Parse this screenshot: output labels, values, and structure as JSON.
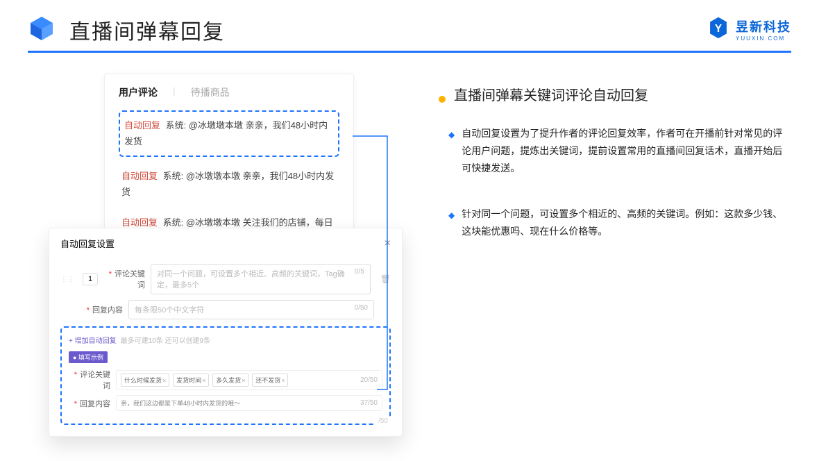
{
  "header": {
    "title": "直播间弹幕回复",
    "brand_name": "昱新科技",
    "brand_sub": "YUUXIN.COM"
  },
  "comments": {
    "tab_active": "用户评论",
    "tab_inactive": "待播商品",
    "rows": [
      {
        "label": "自动回复",
        "text": "系统: @冰墩墩本墩 亲亲，我们48小时内发货"
      },
      {
        "label": "自动回复",
        "text": "系统: @冰墩墩本墩 亲亲，我们48小时内发货"
      },
      {
        "label": "自动回复",
        "text": "系统: @冰墩墩本墩 关注我们的店铺，每日都有热门推荐呦～"
      }
    ]
  },
  "settings": {
    "title": "自动回复设置",
    "index": "1",
    "label_keyword": "评论关键词",
    "ph_keyword": "对同一个问题，可设置多个相近、高频的关键词，Tag确定，最多5个",
    "count_keyword": "0/5",
    "label_content": "回复内容",
    "ph_content": "每条限50个中文字符",
    "count_content": "0/50",
    "add_link": "+ 增加自动回复",
    "add_hint": "最多可建10条 还可以创建9条",
    "example_badge": "● 填写示例",
    "ex_label_keyword": "评论关键词",
    "tags": [
      "什么时候发货",
      "发货时间",
      "多久发货",
      "还不发货"
    ],
    "ex_count_keyword": "20/50",
    "ex_label_content": "回复内容",
    "ex_content": "亲，我们这边都是下单48小时内发货的哦～",
    "ex_count_content": "37/50",
    "ghost_count": "/50"
  },
  "right": {
    "section_title": "直播间弹幕关键词评论自动回复",
    "bullets": [
      "自动回复设置为了提升作者的评论回复效率，作者可在开播前针对常见的评论用户问题，提炼出关键词，提前设置常用的直播间回复话术，直播开始后可快捷发送。",
      "针对同一个问题，可设置多个相近的、高频的关键词。例如：这款多少钱、这块能优惠吗、现在什么价格等。"
    ]
  }
}
